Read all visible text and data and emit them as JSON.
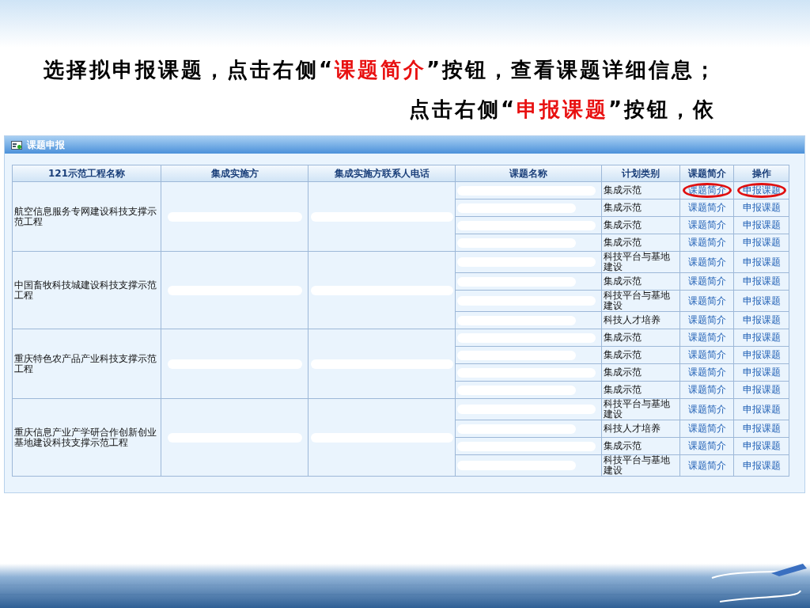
{
  "instructions": [
    {
      "segments": [
        {
          "text": "选择拟申报课题，点击右侧“",
          "emphasis": false
        },
        {
          "text": "课题简介",
          "emphasis": true
        },
        {
          "text": "”按钮，查看课题详细信息；",
          "emphasis": false
        }
      ]
    },
    {
      "segments": [
        {
          "text": "点击右侧“",
          "emphasis": false
        },
        {
          "text": "申报课题",
          "emphasis": true
        },
        {
          "text": "”按钮，依",
          "emphasis": false
        }
      ]
    }
  ],
  "panel": {
    "title": "课题申报",
    "columns": [
      "121示范工程名称",
      "集成实施方",
      "集成实施方联系人电话",
      "课题名称",
      "计划类别",
      "课题简介",
      "操作"
    ],
    "projects": [
      {
        "name": "航空信息服务专网建设科技支撑示范工程",
        "topics": [
          {
            "category": "集成示范",
            "intro_link": "课题简介",
            "apply_link": "申报课题",
            "circled": true
          },
          {
            "category": "集成示范",
            "intro_link": "课题简介",
            "apply_link": "申报课题",
            "circled": false
          },
          {
            "category": "集成示范",
            "intro_link": "课题简介",
            "apply_link": "申报课题",
            "circled": false
          },
          {
            "category": "集成示范",
            "intro_link": "课题简介",
            "apply_link": "申报课题",
            "circled": false
          }
        ]
      },
      {
        "name": "中国畜牧科技城建设科技支撑示范工程",
        "topics": [
          {
            "category": "科技平台与基地建设",
            "intro_link": "课题简介",
            "apply_link": "申报课题",
            "circled": false
          },
          {
            "category": "集成示范",
            "intro_link": "课题简介",
            "apply_link": "申报课题",
            "circled": false
          },
          {
            "category": "科技平台与基地建设",
            "intro_link": "课题简介",
            "apply_link": "申报课题",
            "circled": false
          },
          {
            "category": "科技人才培养",
            "intro_link": "课题简介",
            "apply_link": "申报课题",
            "circled": false
          }
        ]
      },
      {
        "name": "重庆特色农产品产业科技支撑示范工程",
        "topics": [
          {
            "category": "集成示范",
            "intro_link": "课题简介",
            "apply_link": "申报课题",
            "circled": false
          },
          {
            "category": "集成示范",
            "intro_link": "课题简介",
            "apply_link": "申报课题",
            "circled": false
          },
          {
            "category": "集成示范",
            "intro_link": "课题简介",
            "apply_link": "申报课题",
            "circled": false
          },
          {
            "category": "集成示范",
            "intro_link": "课题简介",
            "apply_link": "申报课题",
            "circled": false
          }
        ]
      },
      {
        "name": "重庆信息产业产学研合作创新创业基地建设科技支撑示范工程",
        "topics": [
          {
            "category": "科技平台与基地建设",
            "intro_link": "课题简介",
            "apply_link": "申报课题",
            "circled": false
          },
          {
            "category": "科技人才培养",
            "intro_link": "课题简介",
            "apply_link": "申报课题",
            "circled": false
          },
          {
            "category": "集成示范",
            "intro_link": "课题简介",
            "apply_link": "申报课题",
            "circled": false
          },
          {
            "category": "科技平台与基地建设",
            "intro_link": "课题简介",
            "apply_link": "申报课题",
            "circled": false
          }
        ]
      }
    ]
  }
}
